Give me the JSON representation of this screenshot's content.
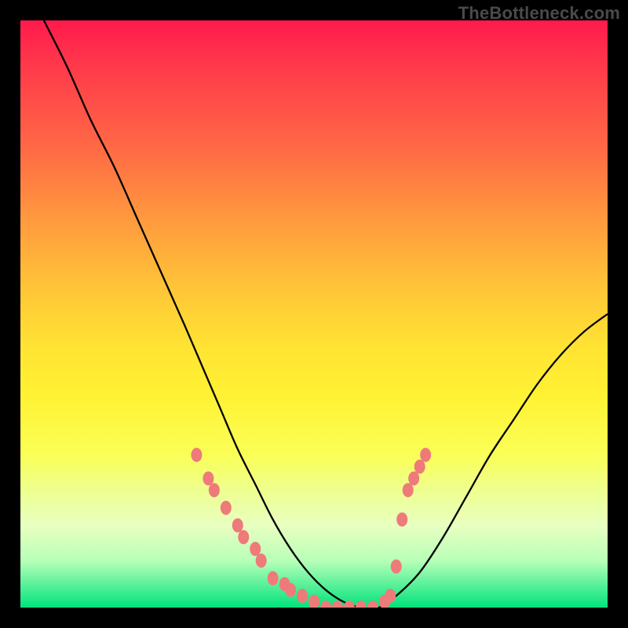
{
  "watermark": "TheBottleneck.com",
  "chart_data": {
    "type": "line",
    "title": "",
    "xlabel": "",
    "ylabel": "",
    "xlim": [
      0,
      100
    ],
    "ylim": [
      0,
      100
    ],
    "grid": false,
    "legend": false,
    "background_gradient": [
      "#ff1a4d",
      "#ff9a3e",
      "#ffe433",
      "#faff57",
      "#00e37d"
    ],
    "series": [
      {
        "name": "bottleneck-curve",
        "color": "#000000",
        "x": [
          4,
          8,
          12,
          16,
          20,
          24,
          28,
          31,
          34,
          37,
          40,
          43,
          46,
          49,
          52,
          55,
          58,
          61,
          64,
          68,
          72,
          76,
          80,
          84,
          88,
          92,
          96,
          100
        ],
        "y": [
          100,
          92,
          83,
          75,
          66,
          57,
          48,
          41,
          34,
          27,
          21,
          15,
          10,
          6,
          3,
          1,
          0,
          0,
          2,
          6,
          12,
          19,
          26,
          32,
          38,
          43,
          47,
          50
        ]
      }
    ],
    "markers": {
      "color": "#ef7a7a",
      "points": [
        {
          "x": 30,
          "y": 26
        },
        {
          "x": 32,
          "y": 22
        },
        {
          "x": 33,
          "y": 20
        },
        {
          "x": 35,
          "y": 17
        },
        {
          "x": 37,
          "y": 14
        },
        {
          "x": 38,
          "y": 12
        },
        {
          "x": 40,
          "y": 10
        },
        {
          "x": 41,
          "y": 8
        },
        {
          "x": 43,
          "y": 5
        },
        {
          "x": 45,
          "y": 4
        },
        {
          "x": 46,
          "y": 3
        },
        {
          "x": 48,
          "y": 2
        },
        {
          "x": 50,
          "y": 1
        },
        {
          "x": 52,
          "y": 0
        },
        {
          "x": 54,
          "y": 0
        },
        {
          "x": 56,
          "y": 0
        },
        {
          "x": 58,
          "y": 0
        },
        {
          "x": 60,
          "y": 0
        },
        {
          "x": 62,
          "y": 1
        },
        {
          "x": 63,
          "y": 2
        },
        {
          "x": 64,
          "y": 7
        },
        {
          "x": 65,
          "y": 15
        },
        {
          "x": 66,
          "y": 20
        },
        {
          "x": 67,
          "y": 22
        },
        {
          "x": 68,
          "y": 24
        },
        {
          "x": 69,
          "y": 26
        }
      ]
    }
  }
}
